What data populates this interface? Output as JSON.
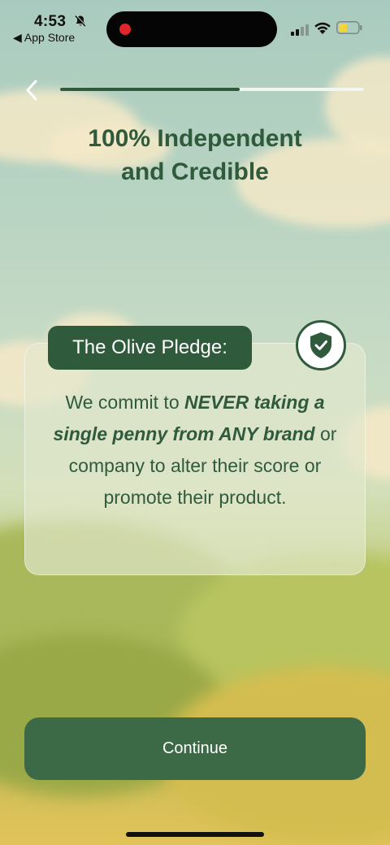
{
  "status_bar": {
    "time": "4:53",
    "back_app": "App Store",
    "battery_color": "#f5d33a"
  },
  "onboarding": {
    "progress_fraction": 0.59,
    "title_line1": "100% Independent",
    "title_line2": "and Credible"
  },
  "pledge": {
    "label": "The Olive Pledge:",
    "text_1": "We commit to ",
    "text_em": "NEVER taking a single penny from ANY brand",
    "text_2": " or company to alter their score or promote their product."
  },
  "actions": {
    "continue_label": "Continue"
  },
  "theme": {
    "primary": "#2f5a3c",
    "button": "#3d6a46"
  }
}
